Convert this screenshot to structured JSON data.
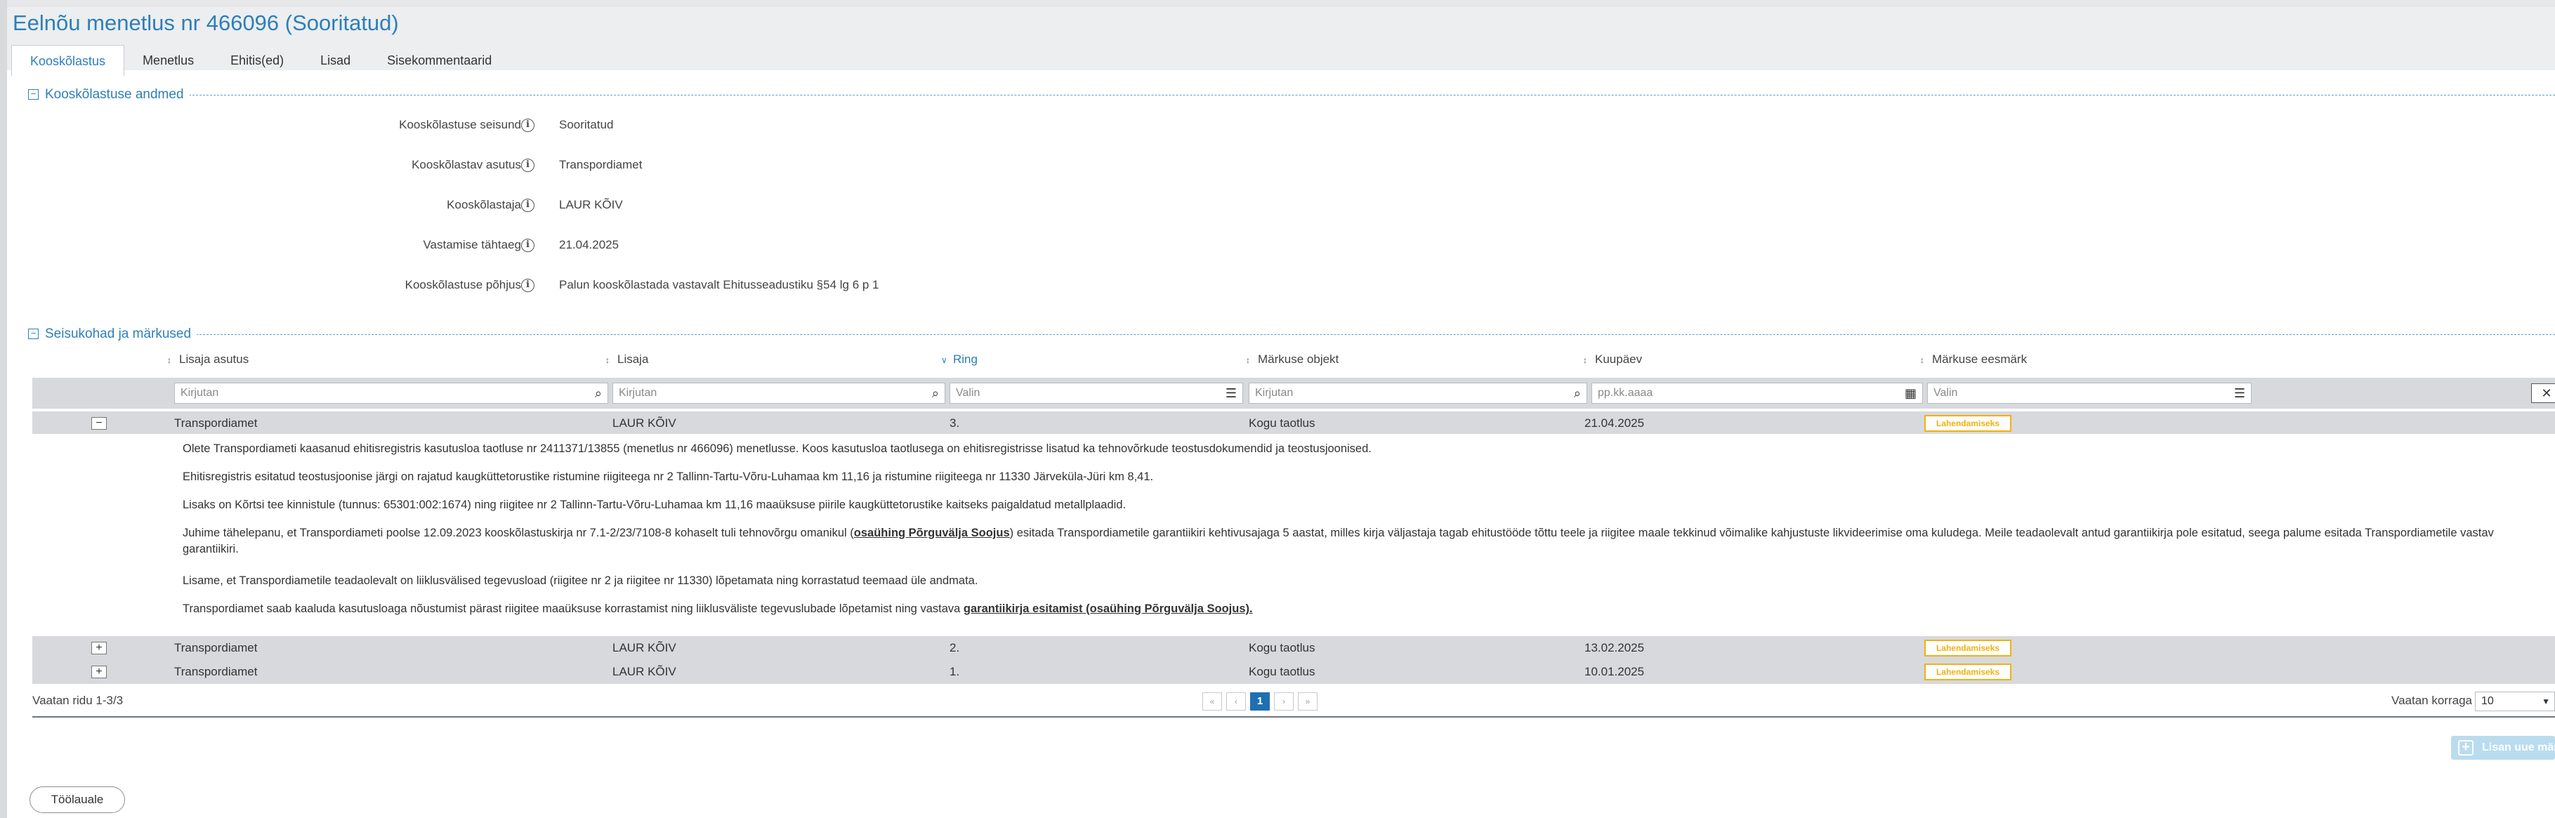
{
  "page": {
    "title": "Eelnõu menetlus nr 466096 (Sooritatud)"
  },
  "tabs": [
    {
      "label": "Kooskõlastus"
    },
    {
      "label": "Menetlus"
    },
    {
      "label": "Ehitis(ed)"
    },
    {
      "label": "Lisad"
    },
    {
      "label": "Sisekommentaarid"
    }
  ],
  "agreement": {
    "section_title": "Kooskõlastuse andmed",
    "fields": [
      {
        "label": "Kooskõlastuse seisund",
        "value": "Sooritatud"
      },
      {
        "label": "Kooskõlastav asutus",
        "value": "Transpordiamet"
      },
      {
        "label": "Kooskõlastaja",
        "value": "LAUR KÕIV"
      },
      {
        "label": "Vastamise tähtaeg",
        "value": "21.04.2025"
      },
      {
        "label": "Kooskõlastuse põhjus",
        "value": "Palun kooskõlastada vastavalt Ehitusseadustiku §54 lg 6 p 1"
      }
    ]
  },
  "positions": {
    "section_title": "Seisukohad ja märkused",
    "columns": [
      {
        "label": "Lisaja asutus",
        "sort": "↕"
      },
      {
        "label": "Lisaja",
        "sort": "↕"
      },
      {
        "label": "Ring",
        "sort": "∨"
      },
      {
        "label": "Märkuse objekt",
        "sort": "↕"
      },
      {
        "label": "Kuupäev",
        "sort": "↕"
      },
      {
        "label": "Märkuse eesmärk",
        "sort": "↕"
      }
    ],
    "filters": {
      "institution_placeholder": "Kirjutan",
      "author_placeholder": "Kirjutan",
      "round_placeholder": "Valin",
      "object_placeholder": "Kirjutan",
      "date_placeholder": "pp.kk.aaaa",
      "purpose_placeholder": "Valin"
    },
    "rows": [
      {
        "toggle": "−",
        "institution": "Transpordiamet",
        "author": "LAUR KÕIV",
        "round": "3.",
        "object": "Kogu taotlus",
        "date": "21.04.2025",
        "purpose": "Lahendamiseks"
      },
      {
        "toggle": "+",
        "institution": "Transpordiamet",
        "author": "LAUR KÕIV",
        "round": "2.",
        "object": "Kogu taotlus",
        "date": "13.02.2025",
        "purpose": "Lahendamiseks"
      },
      {
        "toggle": "+",
        "institution": "Transpordiamet",
        "author": "LAUR KÕIV",
        "round": "1.",
        "object": "Kogu taotlus",
        "date": "10.01.2025",
        "purpose": "Lahendamiseks"
      }
    ],
    "detail": {
      "p1": "Olete Transpordiameti kaasanud ehitisregistris kasutusloa taotluse nr 2411371/13855 (menetlus nr 466096) menetlusse. Koos kasutusloa taotlusega on ehitisregistrisse lisatud ka tehnovõrkude teostusdokumendid ja teostusjoonised.",
      "p2": "Ehitisregistris esitatud teostusjoonise järgi on rajatud kaugküttetorustike ristumine riigiteega nr 2 Tallinn-Tartu-Võru-Luhamaa km 11,16 ja ristumine riigiteega nr 11330 Järveküla-Jüri km 8,41.",
      "p3": "Lisaks on Kõrtsi tee kinnistule (tunnus: 65301:002:1674) ning riigitee nr 2 Tallinn-Tartu-Võru-Luhamaa km 11,16 maaüksuse piirile kaugküttetorustike kaitseks paigaldatud metallplaadid.",
      "p4_a": "Juhime tähelepanu, et Transpordiameti poolse 12.09.2023 kooskõlastuskirja nr 7.1-2/23/7108-8 kohaselt tuli tehnovõrgu omanikul (",
      "p4_b": "osaühing Põrguvälja Soojus",
      "p4_c": ") esitada Transpordiametile garantiikiri kehtivusajaga 5 aastat, milles kirja väljastaja tagab ehitustööde tõttu teele ja riigitee maale tekkinud võimalike kahjustuste likvideerimise oma kuludega. Meile teadaolevalt antud garantiikirja pole esitatud, seega palume esitada Transpordiametile vastav garantiikiri.",
      "p5": "Lisame, et Transpordiametile teadaolevalt on liiklusvälised tegevusload (riigitee nr 2 ja riigitee nr 11330) lõpetamata ning korrastatud teemaad üle andmata.",
      "p6_a": "Transpordiamet saab kaaluda kasutusloaga nõustumist pärast riigitee maaüksuse korrastamist ning liiklusväliste tegevuslubade lõpetamist ning vastava ",
      "p6_b": "garantiikirja esitamist (osaühing Põrguvälja Soojus)."
    },
    "footer": {
      "rows_info": "Vaatan ridu 1-3/3",
      "pages": [
        "«",
        "‹",
        "1",
        "›",
        "»"
      ],
      "per_page_label": "Vaatan korraga",
      "per_page_value": "10"
    },
    "add_button": "Lisan uue märkuse"
  },
  "back_button": "Töölauale",
  "colors": {
    "accent": "#2d7fb8",
    "badge": "#f2b10c",
    "row_bg": "#d7d9dc"
  }
}
